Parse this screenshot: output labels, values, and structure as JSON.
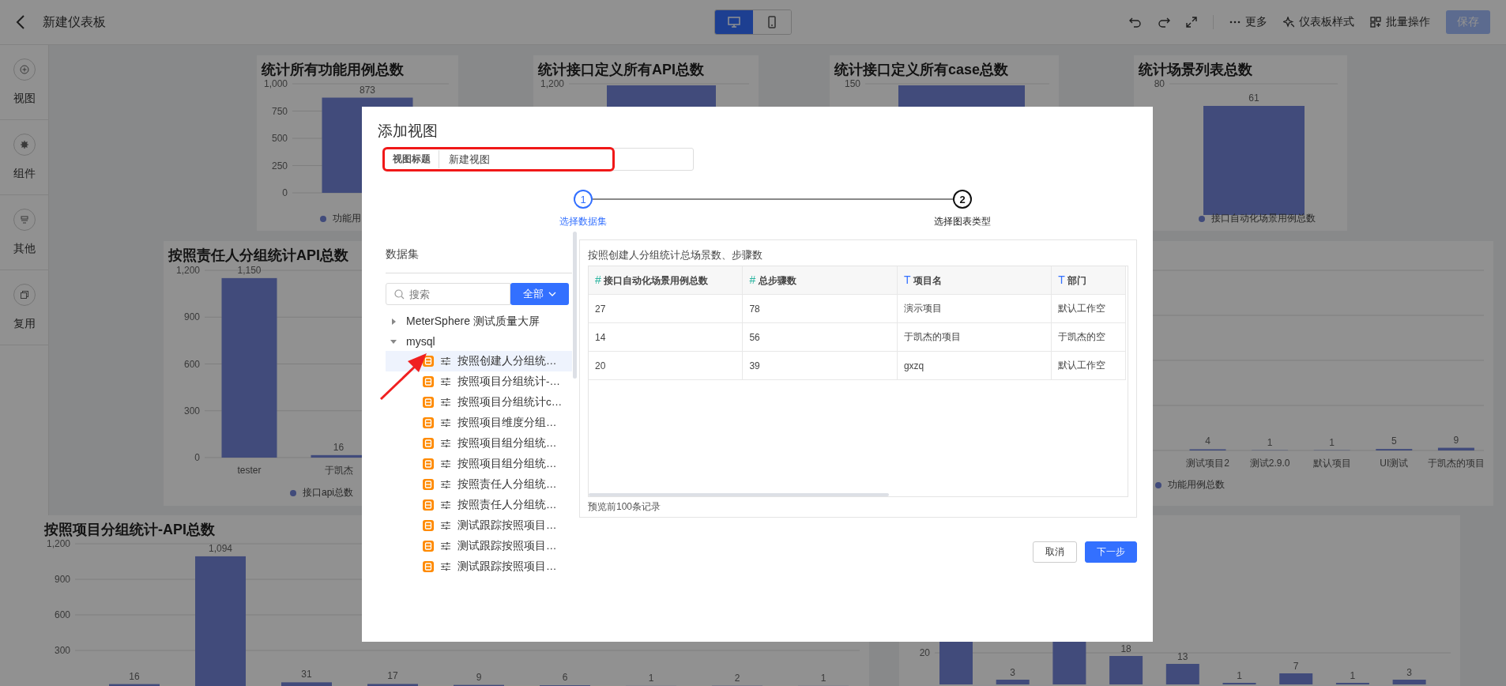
{
  "top_bar": {
    "title": "新建仪表板",
    "view_modes": [
      {
        "kind": "desktop",
        "selected": true
      },
      {
        "kind": "mobile",
        "selected": false
      }
    ],
    "more": "更多",
    "style": "仪表板样式",
    "batch": "批量操作",
    "save": {
      "label": "保存",
      "disabled": true
    }
  },
  "sidebar": {
    "items": [
      {
        "kind": "view",
        "label": "视图"
      },
      {
        "kind": "component",
        "label": "组件"
      },
      {
        "kind": "other",
        "label": "其他"
      },
      {
        "kind": "reuse",
        "label": "复用"
      }
    ]
  },
  "dashboard": {
    "charts": [
      {
        "title": "统计所有功能用例总数",
        "legend": "功能用",
        "chart_data": {
          "type": "bar",
          "grid": true,
          "ylim": [
            0,
            1000
          ],
          "yticks": [
            0,
            250,
            500,
            750,
            {
              "value": 1000,
              "label": "1,000"
            }
          ],
          "values": [
            873
          ],
          "value_labels": [
            "873"
          ]
        }
      },
      {
        "title": "统计接口定义所有API总数",
        "axis_label": "1,200"
      },
      {
        "title": "统计接口定义所有case总数",
        "axis_label": "150"
      },
      {
        "title": "统计场景列表总数",
        "axis_label": "80",
        "bar_label": "61",
        "legend": "接口自动化场景用例总数"
      },
      {
        "title": "按照责任人分组统计API总数",
        "legend": "接口api总数",
        "chart_data": {
          "type": "bar",
          "grid": true,
          "ylim": [
            0,
            1200
          ],
          "yticks": [
            {
              "value": 0,
              "label": "0"
            },
            {
              "value": 300,
              "label": "300"
            },
            {
              "value": 600,
              "label": "600"
            },
            {
              "value": 900,
              "label": "900"
            },
            {
              "value": 1200,
              "label": "1,200"
            }
          ],
          "categories": [
            "tester",
            "于凯杰",
            null
          ],
          "values": [
            1150,
            16,
            null
          ],
          "value_labels": [
            "1,150",
            "16",
            null
          ]
        }
      },
      {
        "legend": "功能用例总数",
        "chart_data": {
          "type": "bar",
          "grid": true,
          "categories": [
            null,
            null,
            null,
            null,
            null,
            "测试项目2",
            "测试2.9.0",
            "默认项目",
            "UI测试",
            "于凯杰的项目"
          ],
          "values": [
            null,
            null,
            null,
            null,
            null,
            4,
            1,
            1,
            5,
            9
          ],
          "value_labels": [
            null,
            null,
            null,
            null,
            null,
            "4",
            "1",
            "1",
            "5",
            "9"
          ]
        }
      },
      {
        "title": "按照项目分组统计-API总数",
        "chart_data": {
          "type": "bar",
          "grid": true,
          "ylim": [
            0,
            1200
          ],
          "yticks": [
            {
              "value": 300,
              "label": "300"
            },
            {
              "value": 600,
              "label": "600"
            },
            {
              "value": 900,
              "label": "900"
            },
            {
              "value": 1200,
              "label": "1,200"
            }
          ],
          "values": [
            16,
            1094,
            31,
            17,
            9,
            6,
            1,
            2,
            1
          ],
          "value_labels": [
            "16",
            "1,094",
            "31",
            "17",
            "9",
            "6",
            "1",
            "2",
            "1"
          ]
        }
      },
      {
        "axis_label": "20",
        "bar_labels": [
          "3",
          "18",
          "13",
          "1",
          "7",
          "1",
          "3"
        ]
      }
    ]
  },
  "dialog": {
    "title": "添加视图",
    "title_field": {
      "label": "视图标题",
      "value": "新建视图"
    },
    "steps": [
      {
        "number": "1",
        "label": "选择数据集",
        "selected": true
      },
      {
        "number": "2",
        "label": "选择图表类型",
        "selected": false
      }
    ],
    "dataset_panel": {
      "heading": "数据集",
      "search": {
        "placeholder": "搜索"
      },
      "filter": "全部",
      "tree": [
        {
          "label": "MeterSphere 测试质量大屏",
          "expanded": false
        },
        {
          "label": "mysql",
          "expanded": true,
          "children": [
            {
              "label": "按照创建人分组统…",
              "selected": true
            },
            {
              "label": "按照项目分组统计-…",
              "selected": false
            },
            {
              "label": "按照项目分组统计c…",
              "selected": false
            },
            {
              "label": "按照项目维度分组…",
              "selected": false
            },
            {
              "label": "按照项目组分组统…",
              "selected": false
            },
            {
              "label": "按照项目组分组统…",
              "selected": false
            },
            {
              "label": "按照责任人分组统…",
              "selected": false
            },
            {
              "label": "按照责任人分组统…",
              "selected": false
            },
            {
              "label": "测试跟踪按照项目…",
              "selected": false
            },
            {
              "label": "测试跟踪按照项目…",
              "selected": false
            },
            {
              "label": "测试跟踪按照项目…",
              "selected": false
            }
          ]
        }
      ]
    },
    "preview": {
      "title": "按照创建人分组统计总场景数、步骤数",
      "columns": [
        {
          "icon": "#",
          "kind": "number",
          "label": "接口自动化场景用例总数"
        },
        {
          "icon": "#",
          "kind": "number",
          "label": "总步骤数"
        },
        {
          "icon": "T",
          "kind": "text",
          "label": "项目名"
        },
        {
          "icon": "T",
          "kind": "text",
          "label": "部门"
        }
      ],
      "rows": [
        [
          "27",
          "78",
          "演示项目",
          "默认工作空"
        ],
        [
          "14",
          "56",
          "于凯杰的项目",
          "于凯杰的空"
        ],
        [
          "20",
          "39",
          "gxzq",
          "默认工作空"
        ]
      ],
      "footer": "预览前100条记录"
    },
    "buttons": [
      {
        "kind": "secondary",
        "label": "取消"
      },
      {
        "kind": "primary",
        "label": "下一步"
      }
    ]
  }
}
